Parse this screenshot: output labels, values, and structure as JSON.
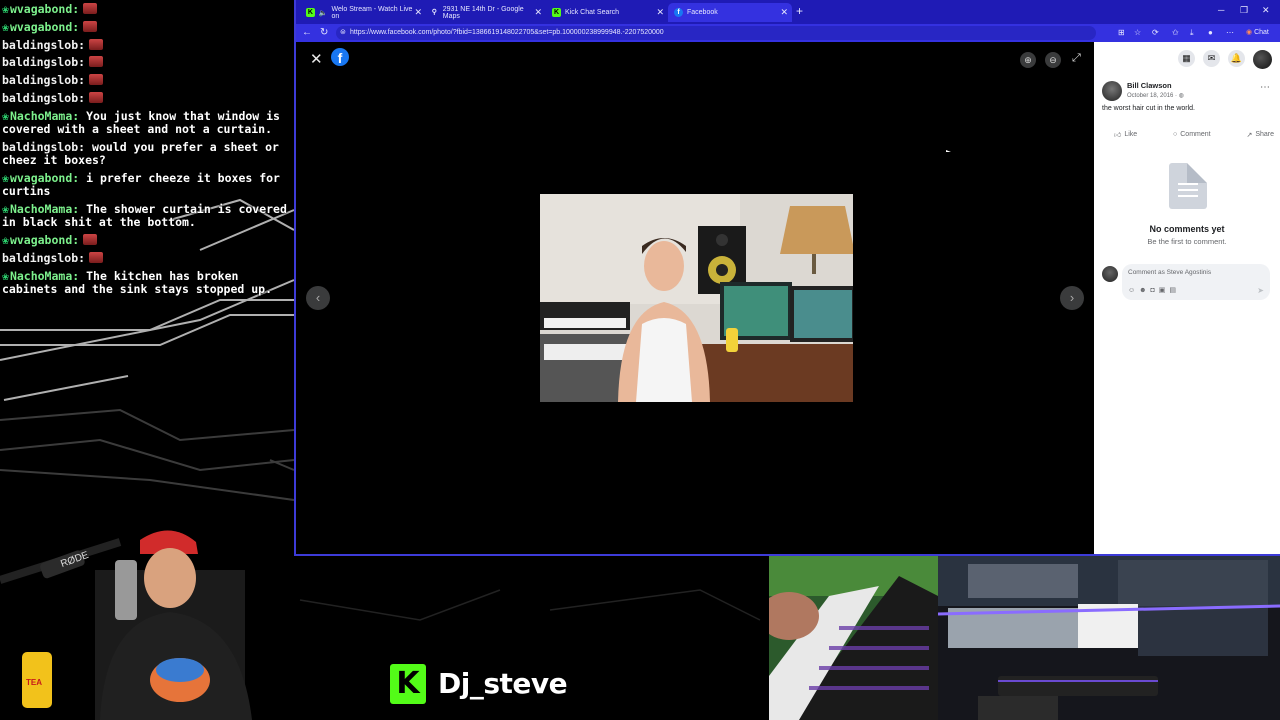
{
  "chat": {
    "messages": [
      {
        "user": "wvagabond:",
        "text": "",
        "emote": true,
        "badge": true
      },
      {
        "user": "wvagabond:",
        "text": "",
        "emote": true,
        "badge": true
      },
      {
        "user": "baldingslob:",
        "text": "",
        "emote": true,
        "badge": false
      },
      {
        "user": "baldingslob:",
        "text": "",
        "emote": true,
        "badge": false
      },
      {
        "user": "baldingslob:",
        "text": "",
        "emote": true,
        "badge": false
      },
      {
        "user": "baldingslob:",
        "text": "",
        "emote": true,
        "badge": false
      },
      {
        "user": "NachoMama:",
        "text": "You just know that window is covered with a sheet and not a curtain.",
        "emote": false,
        "badge": true
      },
      {
        "user": "baldingslob:",
        "text": "would you prefer a sheet or cheez it boxes?",
        "emote": false,
        "badge": false
      },
      {
        "user": "wvagabond:",
        "text": "i prefer cheeze it boxes for curtins",
        "emote": false,
        "badge": true
      },
      {
        "user": "NachoMama:",
        "text": "The shower curtain is covered in black shit at the bottom.",
        "emote": false,
        "badge": true
      },
      {
        "user": "wvagabond:",
        "text": "",
        "emote": true,
        "badge": true
      },
      {
        "user": "baldingslob:",
        "text": "",
        "emote": true,
        "badge": false
      },
      {
        "user": "NachoMama:",
        "text": "The kitchen has broken cabinets and the sink stays stopped up.",
        "emote": false,
        "badge": true
      }
    ]
  },
  "browser": {
    "tabs": [
      {
        "label": "Welo Stream - Watch Live on",
        "icon": "kick-icon"
      },
      {
        "label": "2931 NE 14th Dr - Google Maps",
        "icon": "maps-pin-icon"
      },
      {
        "label": "Kick Chat Search",
        "icon": "kick-icon"
      },
      {
        "label": "Facebook",
        "icon": "facebook-icon"
      }
    ],
    "url": "https://www.facebook.com/photo/?fbid=1386619148022705&set=pb.100000238999948.-2207520000",
    "chat_label": "Chat"
  },
  "post": {
    "author": "Bill Clawson",
    "date": "October 18, 2016 · ",
    "caption": "the worst hair cut in the world.",
    "actions": {
      "like": "Like",
      "comment": "Comment",
      "share": "Share"
    },
    "no_comments": "No comments yet",
    "first_comment": "Be the first to comment.",
    "comment_placeholder": "Comment as Steve Agostinis"
  },
  "stream": {
    "streamer_name": "Dj_steve",
    "kick_letter": "K"
  },
  "colors": {
    "tabbar": "#1f1bb5",
    "facebook_blue": "#1877f2",
    "kick_green": "#53fc18"
  }
}
